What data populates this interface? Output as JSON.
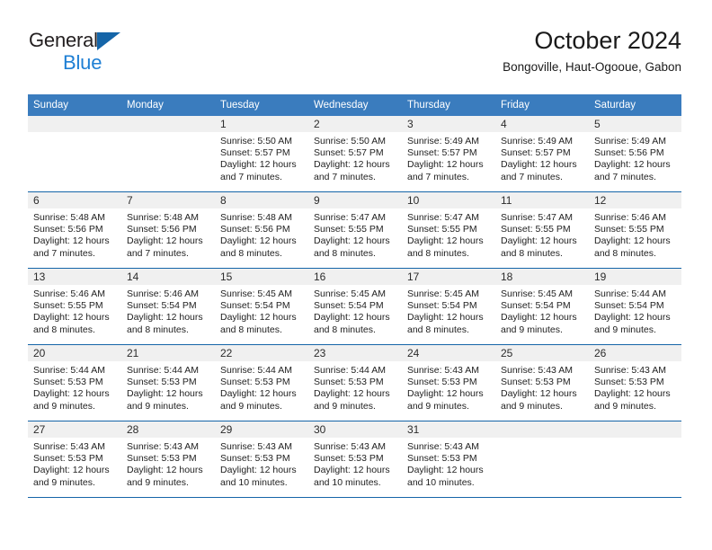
{
  "brand": {
    "name_part1": "General",
    "name_part2": "Blue"
  },
  "header": {
    "title": "October 2024",
    "subtitle": "Bongoville, Haut-Ogooue, Gabon"
  },
  "colors": {
    "header_band": "#3a7cbe",
    "row_rule": "#1565a8",
    "daynum_band": "#f0f0f0",
    "brand_blue": "#1e7fd4",
    "text": "#222222"
  },
  "weekday_headers": [
    "Sunday",
    "Monday",
    "Tuesday",
    "Wednesday",
    "Thursday",
    "Friday",
    "Saturday"
  ],
  "labels": {
    "sunrise_prefix": "Sunrise: ",
    "sunset_prefix": "Sunset: ",
    "daylight_prefix": "Daylight: "
  },
  "weeks": [
    [
      {
        "day": "",
        "sunrise": "",
        "sunset": "",
        "daylight_line1": "",
        "daylight_line2": ""
      },
      {
        "day": "",
        "sunrise": "",
        "sunset": "",
        "daylight_line1": "",
        "daylight_line2": ""
      },
      {
        "day": "1",
        "sunrise": "Sunrise: 5:50 AM",
        "sunset": "Sunset: 5:57 PM",
        "daylight_line1": "Daylight: 12 hours",
        "daylight_line2": "and 7 minutes."
      },
      {
        "day": "2",
        "sunrise": "Sunrise: 5:50 AM",
        "sunset": "Sunset: 5:57 PM",
        "daylight_line1": "Daylight: 12 hours",
        "daylight_line2": "and 7 minutes."
      },
      {
        "day": "3",
        "sunrise": "Sunrise: 5:49 AM",
        "sunset": "Sunset: 5:57 PM",
        "daylight_line1": "Daylight: 12 hours",
        "daylight_line2": "and 7 minutes."
      },
      {
        "day": "4",
        "sunrise": "Sunrise: 5:49 AM",
        "sunset": "Sunset: 5:57 PM",
        "daylight_line1": "Daylight: 12 hours",
        "daylight_line2": "and 7 minutes."
      },
      {
        "day": "5",
        "sunrise": "Sunrise: 5:49 AM",
        "sunset": "Sunset: 5:56 PM",
        "daylight_line1": "Daylight: 12 hours",
        "daylight_line2": "and 7 minutes."
      }
    ],
    [
      {
        "day": "6",
        "sunrise": "Sunrise: 5:48 AM",
        "sunset": "Sunset: 5:56 PM",
        "daylight_line1": "Daylight: 12 hours",
        "daylight_line2": "and 7 minutes."
      },
      {
        "day": "7",
        "sunrise": "Sunrise: 5:48 AM",
        "sunset": "Sunset: 5:56 PM",
        "daylight_line1": "Daylight: 12 hours",
        "daylight_line2": "and 7 minutes."
      },
      {
        "day": "8",
        "sunrise": "Sunrise: 5:48 AM",
        "sunset": "Sunset: 5:56 PM",
        "daylight_line1": "Daylight: 12 hours",
        "daylight_line2": "and 8 minutes."
      },
      {
        "day": "9",
        "sunrise": "Sunrise: 5:47 AM",
        "sunset": "Sunset: 5:55 PM",
        "daylight_line1": "Daylight: 12 hours",
        "daylight_line2": "and 8 minutes."
      },
      {
        "day": "10",
        "sunrise": "Sunrise: 5:47 AM",
        "sunset": "Sunset: 5:55 PM",
        "daylight_line1": "Daylight: 12 hours",
        "daylight_line2": "and 8 minutes."
      },
      {
        "day": "11",
        "sunrise": "Sunrise: 5:47 AM",
        "sunset": "Sunset: 5:55 PM",
        "daylight_line1": "Daylight: 12 hours",
        "daylight_line2": "and 8 minutes."
      },
      {
        "day": "12",
        "sunrise": "Sunrise: 5:46 AM",
        "sunset": "Sunset: 5:55 PM",
        "daylight_line1": "Daylight: 12 hours",
        "daylight_line2": "and 8 minutes."
      }
    ],
    [
      {
        "day": "13",
        "sunrise": "Sunrise: 5:46 AM",
        "sunset": "Sunset: 5:55 PM",
        "daylight_line1": "Daylight: 12 hours",
        "daylight_line2": "and 8 minutes."
      },
      {
        "day": "14",
        "sunrise": "Sunrise: 5:46 AM",
        "sunset": "Sunset: 5:54 PM",
        "daylight_line1": "Daylight: 12 hours",
        "daylight_line2": "and 8 minutes."
      },
      {
        "day": "15",
        "sunrise": "Sunrise: 5:45 AM",
        "sunset": "Sunset: 5:54 PM",
        "daylight_line1": "Daylight: 12 hours",
        "daylight_line2": "and 8 minutes."
      },
      {
        "day": "16",
        "sunrise": "Sunrise: 5:45 AM",
        "sunset": "Sunset: 5:54 PM",
        "daylight_line1": "Daylight: 12 hours",
        "daylight_line2": "and 8 minutes."
      },
      {
        "day": "17",
        "sunrise": "Sunrise: 5:45 AM",
        "sunset": "Sunset: 5:54 PM",
        "daylight_line1": "Daylight: 12 hours",
        "daylight_line2": "and 8 minutes."
      },
      {
        "day": "18",
        "sunrise": "Sunrise: 5:45 AM",
        "sunset": "Sunset: 5:54 PM",
        "daylight_line1": "Daylight: 12 hours",
        "daylight_line2": "and 9 minutes."
      },
      {
        "day": "19",
        "sunrise": "Sunrise: 5:44 AM",
        "sunset": "Sunset: 5:54 PM",
        "daylight_line1": "Daylight: 12 hours",
        "daylight_line2": "and 9 minutes."
      }
    ],
    [
      {
        "day": "20",
        "sunrise": "Sunrise: 5:44 AM",
        "sunset": "Sunset: 5:53 PM",
        "daylight_line1": "Daylight: 12 hours",
        "daylight_line2": "and 9 minutes."
      },
      {
        "day": "21",
        "sunrise": "Sunrise: 5:44 AM",
        "sunset": "Sunset: 5:53 PM",
        "daylight_line1": "Daylight: 12 hours",
        "daylight_line2": "and 9 minutes."
      },
      {
        "day": "22",
        "sunrise": "Sunrise: 5:44 AM",
        "sunset": "Sunset: 5:53 PM",
        "daylight_line1": "Daylight: 12 hours",
        "daylight_line2": "and 9 minutes."
      },
      {
        "day": "23",
        "sunrise": "Sunrise: 5:44 AM",
        "sunset": "Sunset: 5:53 PM",
        "daylight_line1": "Daylight: 12 hours",
        "daylight_line2": "and 9 minutes."
      },
      {
        "day": "24",
        "sunrise": "Sunrise: 5:43 AM",
        "sunset": "Sunset: 5:53 PM",
        "daylight_line1": "Daylight: 12 hours",
        "daylight_line2": "and 9 minutes."
      },
      {
        "day": "25",
        "sunrise": "Sunrise: 5:43 AM",
        "sunset": "Sunset: 5:53 PM",
        "daylight_line1": "Daylight: 12 hours",
        "daylight_line2": "and 9 minutes."
      },
      {
        "day": "26",
        "sunrise": "Sunrise: 5:43 AM",
        "sunset": "Sunset: 5:53 PM",
        "daylight_line1": "Daylight: 12 hours",
        "daylight_line2": "and 9 minutes."
      }
    ],
    [
      {
        "day": "27",
        "sunrise": "Sunrise: 5:43 AM",
        "sunset": "Sunset: 5:53 PM",
        "daylight_line1": "Daylight: 12 hours",
        "daylight_line2": "and 9 minutes."
      },
      {
        "day": "28",
        "sunrise": "Sunrise: 5:43 AM",
        "sunset": "Sunset: 5:53 PM",
        "daylight_line1": "Daylight: 12 hours",
        "daylight_line2": "and 9 minutes."
      },
      {
        "day": "29",
        "sunrise": "Sunrise: 5:43 AM",
        "sunset": "Sunset: 5:53 PM",
        "daylight_line1": "Daylight: 12 hours",
        "daylight_line2": "and 10 minutes."
      },
      {
        "day": "30",
        "sunrise": "Sunrise: 5:43 AM",
        "sunset": "Sunset: 5:53 PM",
        "daylight_line1": "Daylight: 12 hours",
        "daylight_line2": "and 10 minutes."
      },
      {
        "day": "31",
        "sunrise": "Sunrise: 5:43 AM",
        "sunset": "Sunset: 5:53 PM",
        "daylight_line1": "Daylight: 12 hours",
        "daylight_line2": "and 10 minutes."
      },
      {
        "day": "",
        "sunrise": "",
        "sunset": "",
        "daylight_line1": "",
        "daylight_line2": ""
      },
      {
        "day": "",
        "sunrise": "",
        "sunset": "",
        "daylight_line1": "",
        "daylight_line2": ""
      }
    ]
  ]
}
